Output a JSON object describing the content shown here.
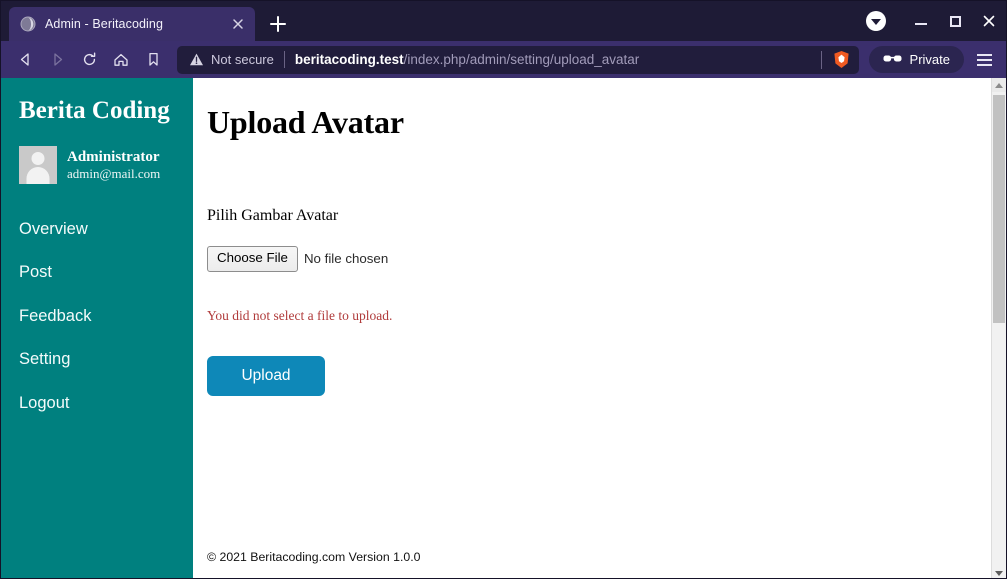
{
  "browser": {
    "tab": {
      "title": "Admin - Beritacoding",
      "favicon_icon": "globe-icon",
      "close_icon": "close-icon"
    },
    "new_tab_label": "+",
    "window_controls": {
      "tab_search_icon": "chevron-down-circle-icon",
      "minimize_icon": "minimize-icon",
      "maximize_icon": "maximize-icon",
      "close_icon": "close-icon"
    },
    "nav": {
      "back_icon": "back-arrow-icon",
      "forward_icon": "forward-arrow-icon",
      "reload_icon": "reload-icon",
      "home_icon": "home-icon",
      "bookmark_icon": "bookmark-icon"
    },
    "address_bar": {
      "security_icon": "warning-triangle-icon",
      "security_label": "Not secure",
      "url_host": "beritacoding.test",
      "url_path": "/index.php/admin/setting/upload_avatar",
      "shield_icon": "brave-lion-icon"
    },
    "private_button": {
      "label": "Private",
      "icon": "sunglasses-icon"
    },
    "menu_icon": "hamburger-menu-icon"
  },
  "sidebar": {
    "brand": "Berita Coding",
    "profile": {
      "avatar_icon": "user-avatar-placeholder",
      "name": "Administrator",
      "email": "admin@mail.com"
    },
    "items": [
      {
        "label": "Overview",
        "name": "sidebar-item-overview"
      },
      {
        "label": "Post",
        "name": "sidebar-item-post"
      },
      {
        "label": "Feedback",
        "name": "sidebar-item-feedback"
      },
      {
        "label": "Setting",
        "name": "sidebar-item-setting"
      },
      {
        "label": "Logout",
        "name": "sidebar-item-logout"
      }
    ]
  },
  "main": {
    "title": "Upload Avatar",
    "field_label": "Pilih Gambar Avatar",
    "file_input": {
      "button_label": "Choose File",
      "status_text": "No file chosen"
    },
    "error_message": "You did not select a file to upload.",
    "submit_label": "Upload",
    "footer": "© 2021 Beritacoding.com Version 1.0.0"
  },
  "scrollbar": {
    "up_icon": "scroll-up-arrow-icon",
    "down_icon": "scroll-down-arrow-icon"
  },
  "colors": {
    "sidebar_teal": "#00807f",
    "button_blue": "#0e88b8",
    "error_red": "#b03b3b",
    "chrome_purple": "#3b2f6d",
    "titlebar_navy": "#1e1b36",
    "tab_active": "#3a2f69"
  }
}
